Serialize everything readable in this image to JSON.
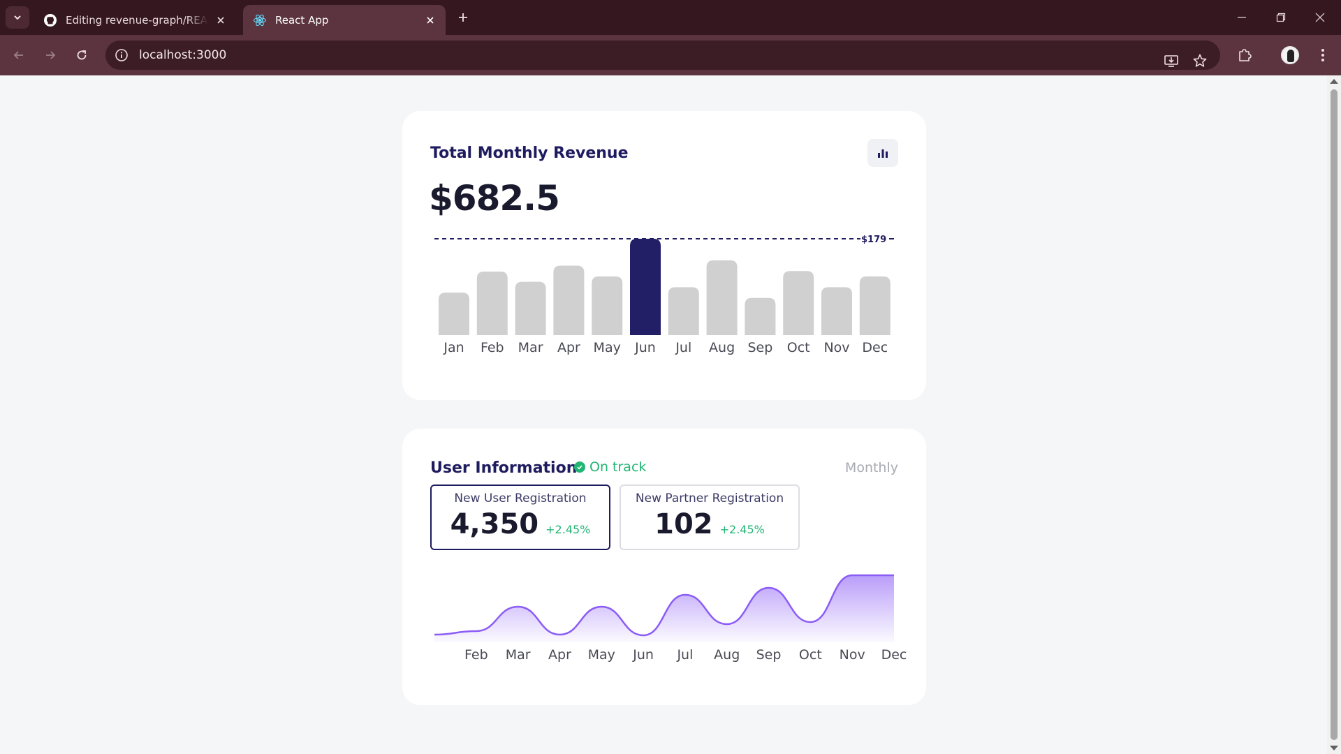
{
  "browser": {
    "tabs": [
      {
        "title": "Editing revenue-graph/README.md",
        "icon": "github-icon",
        "active": false
      },
      {
        "title": "React App",
        "icon": "react-icon",
        "active": true
      }
    ],
    "url": "localhost:3000"
  },
  "revenue_card": {
    "title": "Total Monthly Revenue",
    "total": "$682.5",
    "max_label": "$179",
    "highlight_color": "#221f66",
    "bar_color": "#d0d0d0"
  },
  "users_card": {
    "title": "User Information",
    "status": "On track",
    "period": "Monthly",
    "stats": [
      {
        "label": "New User Registration",
        "value": "4,350",
        "change": "+2.45%"
      },
      {
        "label": "New Partner Registration",
        "value": "102",
        "change": "+2.45%"
      }
    ],
    "line_color": "#8b5cf6"
  },
  "chart_data": [
    {
      "type": "bar",
      "categories": [
        "Jan",
        "Feb",
        "Mar",
        "Apr",
        "May",
        "Jun",
        "Jul",
        "Aug",
        "Sep",
        "Oct",
        "Nov",
        "Dec"
      ],
      "values": [
        79,
        118,
        99,
        129,
        109,
        179,
        89,
        139,
        69,
        119,
        89,
        109
      ],
      "highlight": "Jun",
      "max_line": 179,
      "ylim": [
        0,
        179
      ]
    },
    {
      "type": "area",
      "categories": [
        "Jan",
        "Feb",
        "Mar",
        "Apr",
        "May",
        "Jun",
        "Jul",
        "Aug",
        "Sep",
        "Oct",
        "Nov",
        "Dec"
      ],
      "tick_labels": [
        "Feb",
        "Mar",
        "Apr",
        "May",
        "Jun",
        "Jul",
        "Aug",
        "Sep",
        "Oct",
        "Nov",
        "Dec"
      ],
      "values": [
        5,
        10,
        45,
        5,
        45,
        4,
        62,
        20,
        72,
        23,
        90,
        90
      ],
      "ylim": [
        0,
        100
      ]
    }
  ]
}
